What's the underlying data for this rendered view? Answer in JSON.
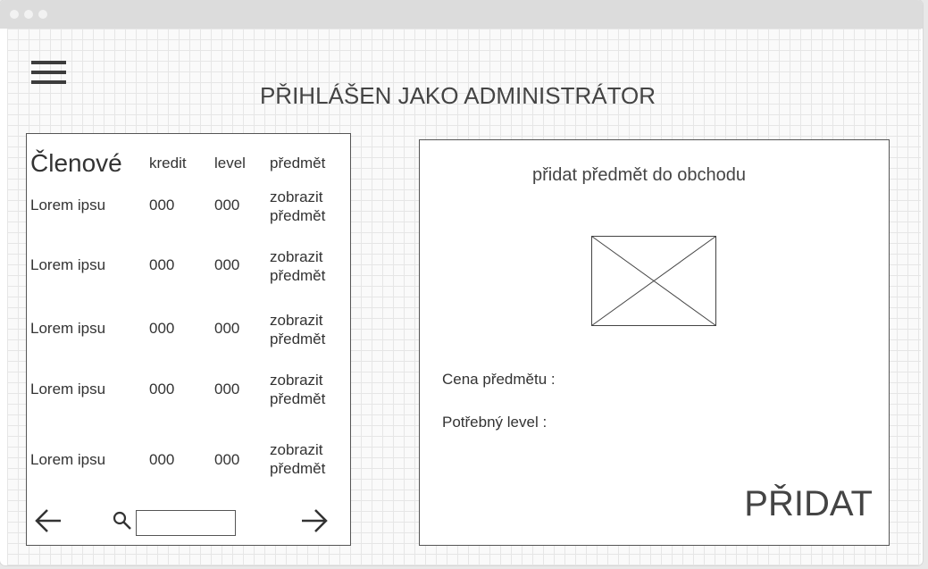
{
  "header": {
    "menu_icon": "hamburger-menu-icon",
    "title": "PŘIHLÁŠEN JAKO ADMINISTRÁTOR"
  },
  "members": {
    "columns": [
      "Členové",
      "kredit",
      "level",
      "předmět"
    ],
    "rows": [
      {
        "name": "Lorem ipsu",
        "kredit": "000",
        "level": "000",
        "link_line1": "zobrazit",
        "link_line2": "předmět"
      },
      {
        "name": "Lorem ipsu",
        "kredit": "000",
        "level": "000",
        "link_line1": "zobrazit",
        "link_line2": "předmět"
      },
      {
        "name": "Lorem ipsu",
        "kredit": "000",
        "level": "000",
        "link_line1": "zobrazit",
        "link_line2": "předmět"
      },
      {
        "name": "Lorem ipsu",
        "kredit": "000",
        "level": "000",
        "link_line1": "zobrazit",
        "link_line2": "předmět"
      },
      {
        "name": "Lorem ipsu",
        "kredit": "000",
        "level": "000",
        "link_line1": "zobrazit",
        "link_line2": "předmět"
      }
    ],
    "prev_icon": "arrow-left-icon",
    "next_icon": "arrow-right-icon",
    "search_icon": "search-icon",
    "search_value": ""
  },
  "add_item": {
    "title": "přidat předmět do obchodu",
    "image_placeholder_icon": "image-placeholder-icon",
    "price_label": "Cena předmětu :",
    "level_label": "Potřebný level :",
    "add_label": "PŘIDAT"
  }
}
